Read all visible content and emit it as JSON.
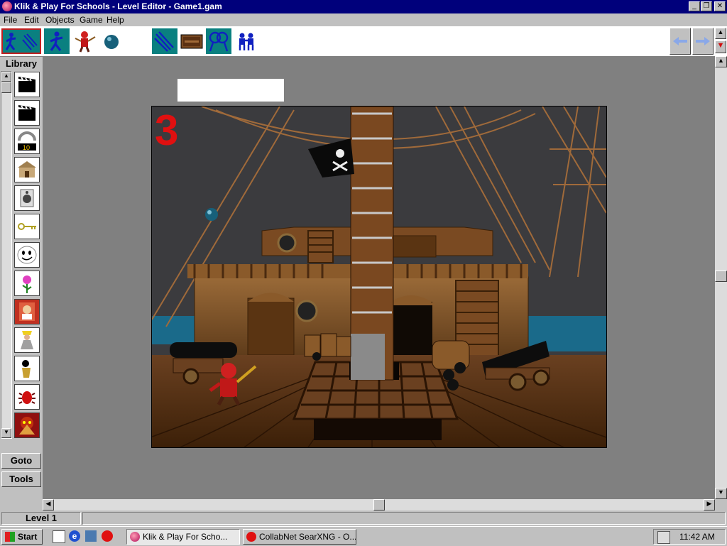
{
  "window": {
    "title": "Klik & Play For Schools - Level Editor - Game1.gam"
  },
  "menu": [
    "File",
    "Edit",
    "Objects",
    "Game",
    "Help"
  ],
  "toolbar": {
    "tools": [
      {
        "icon": "running-man-icon"
      },
      {
        "icon": "pirate-icon"
      },
      {
        "icon": "ball-icon"
      }
    ],
    "views": [
      {
        "icon": "storyboard-view-icon"
      },
      {
        "icon": "level-view-icon"
      },
      {
        "icon": "event-editor-icon"
      },
      {
        "icon": "players-icon"
      }
    ],
    "nav": [
      {
        "icon": "prev-frame-icon"
      },
      {
        "icon": "next-frame-icon"
      }
    ]
  },
  "library": {
    "label": "Library",
    "items": [
      {
        "icon": "clapperboard-icon"
      },
      {
        "icon": "clapperboard-icon"
      },
      {
        "icon": "counter-icon"
      },
      {
        "icon": "building-icon"
      },
      {
        "icon": "speaker-icon"
      },
      {
        "icon": "key-icon"
      },
      {
        "icon": "face-icon"
      },
      {
        "icon": "flower-icon"
      },
      {
        "icon": "monster-icon"
      },
      {
        "icon": "character-icon"
      },
      {
        "icon": "person-icon"
      },
      {
        "icon": "bug-icon"
      },
      {
        "icon": "demon-icon"
      }
    ]
  },
  "sidebar": {
    "goto": "Goto",
    "tools": "Tools"
  },
  "scene": {
    "counter_value": "3"
  },
  "status": {
    "level": "Level 1"
  },
  "taskbar": {
    "start": "Start",
    "tasks": [
      {
        "label": "Klik & Play For Scho..."
      },
      {
        "label": "CollabNet SearXNG - O..."
      }
    ],
    "clock": "11:42 AM"
  },
  "colors": {
    "titlebar": "#00007b",
    "teal": "#0a8080",
    "counter": "#e01010",
    "wood": "#7a4a22"
  }
}
